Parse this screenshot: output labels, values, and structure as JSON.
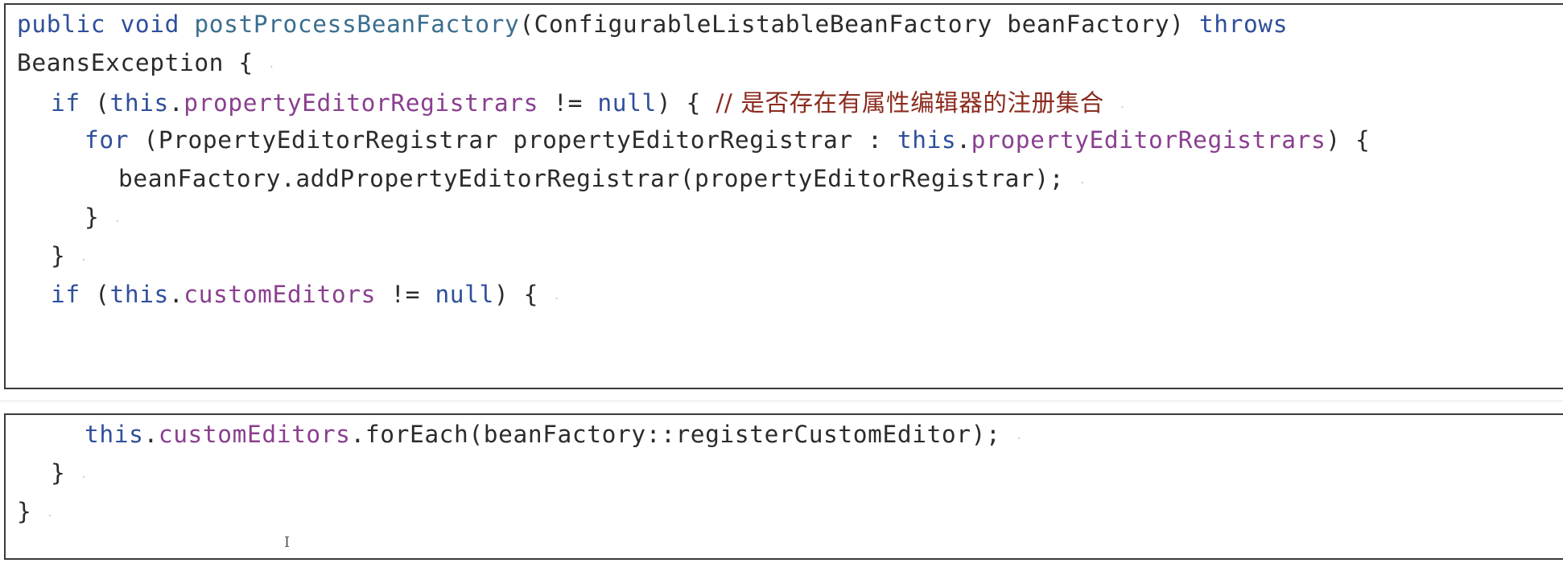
{
  "block1": {
    "lines": [
      {
        "sig_public": "public",
        "sig_void": "void",
        "sig_method": "postProcessBeanFactory",
        "sig_params": "(ConfigurableListableBeanFactory beanFactory)",
        "sig_throws": "throws"
      },
      {
        "text": "BeansException {"
      },
      {
        "if_kw": "if",
        "paren_open": " (",
        "this_kw": "this",
        "dot": ".",
        "field": "propertyEditorRegistrars",
        "neq": " != ",
        "null_kw": "null",
        "close": ") { ",
        "comment": "// 是否存在有属性编辑器的注册集合"
      },
      {
        "for_kw": "for",
        "decl": " (PropertyEditorRegistrar propertyEditorRegistrar : ",
        "this_kw": "this",
        "dot": ".",
        "field": "propertyEditorRegistrars",
        "close": ") {"
      },
      {
        "text": "beanFactory.addPropertyEditorRegistrar(propertyEditorRegistrar);"
      },
      {
        "text": "}"
      },
      {
        "text": "}"
      },
      {
        "if_kw": "if",
        "paren_open": " (",
        "this_kw": "this",
        "dot": ".",
        "field": "customEditors",
        "neq": " != ",
        "null_kw": "null",
        "close": ") {"
      }
    ]
  },
  "block2": {
    "lines": [
      {
        "this_kw": "this",
        "dot": ".",
        "field": "customEditors",
        "rest": ".forEach(beanFactory::registerCustomEditor);"
      },
      {
        "text": "}"
      },
      {
        "text": "}"
      }
    ]
  },
  "para_mark": "·",
  "cursor_glyph": "I"
}
